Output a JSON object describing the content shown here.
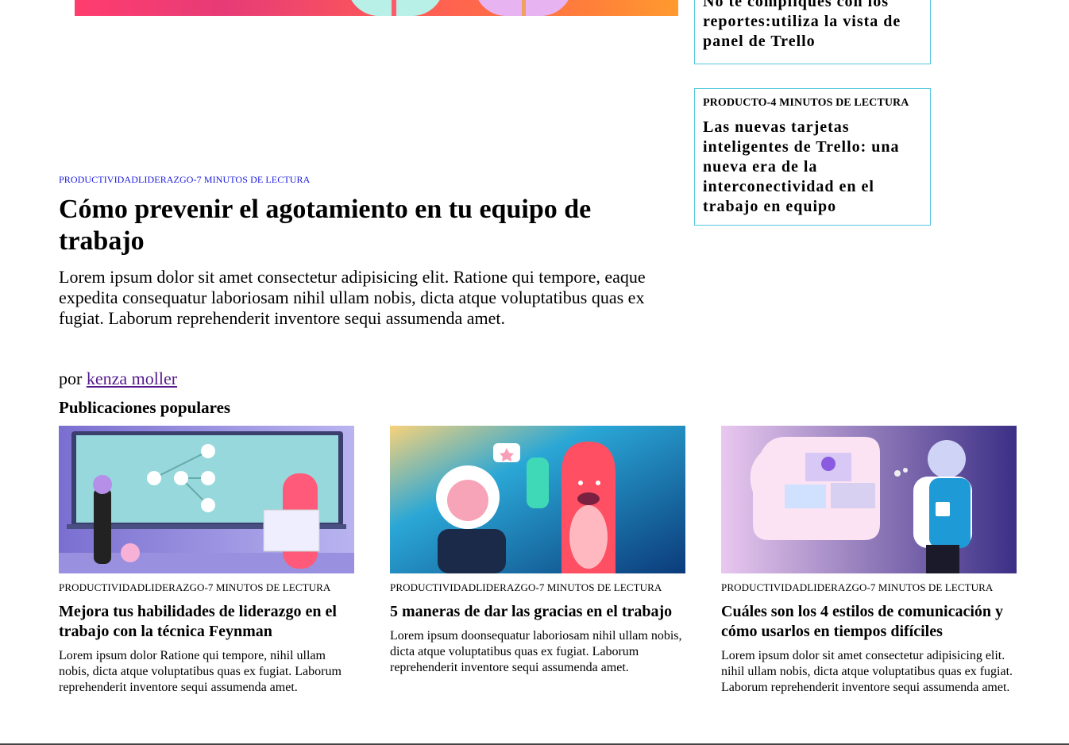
{
  "hero": {
    "image_name": "hero-illustration"
  },
  "sidebar": {
    "cards": [
      {
        "category": "",
        "title": "No te compliques con los reportes:utiliza la vista de panel de Trello"
      },
      {
        "category": "PRODUCTO-4 MINUTOS DE LECTURA",
        "title": "Las nuevas tarjetas inteligentes de Trello: una nueva era de la interconectividad en el trabajo en equipo"
      }
    ]
  },
  "featured": {
    "category": "PRODUCTIVIDADLIDERAZGO-7 MINUTOS DE LECTURA",
    "title": "Cómo prevenir el agotamiento en tu equipo de trabajo",
    "description": "Lorem ipsum dolor sit amet consectetur adipisicing elit. Ratione qui tempore, eaque expedita consequatur laboriosam nihil ullam nobis, dicta atque voluptatibus quas ex fugiat. Laborum reprehenderit inventore sequi assumenda amet.",
    "by_prefix": "por",
    "author": "kenza moller"
  },
  "popular": {
    "heading": "Publicaciones populares",
    "posts": [
      {
        "category": "PRODUCTIVIDADLIDERAZGO-7 MINUTOS DE LECTURA",
        "title": "Mejora tus habilidades de liderazgo en el trabajo con la técnica Feynman",
        "description": "Lorem ipsum dolor Ratione qui tempore, nihil ullam nobis, dicta atque voluptatibus quas ex fugiat. Laborum reprehenderit inventore sequi assumenda amet."
      },
      {
        "category": "PRODUCTIVIDADLIDERAZGO-7 MINUTOS DE LECTURA",
        "title": "5 maneras de dar las gracias en el trabajo",
        "description": "Lorem ipsum doonsequatur laboriosam nihil ullam nobis, dicta atque voluptatibus quas ex fugiat. Laborum reprehenderit inventore sequi assumenda amet."
      },
      {
        "category": "PRODUCTIVIDADLIDERAZGO-7 MINUTOS DE LECTURA",
        "title": "Cuáles son los 4 estilos de comunicación y cómo usarlos en tiempos difíciles",
        "description": "Lorem ipsum dolor sit amet consectetur adipisicing elit. nihil ullam nobis, dicta atque voluptatibus quas ex fugiat. Laborum reprehenderit inventore sequi assumenda amet."
      }
    ]
  },
  "colors": {
    "card_border": "#53c6dc",
    "category_link": "#1a1ae0",
    "author_link": "#551a8b"
  }
}
